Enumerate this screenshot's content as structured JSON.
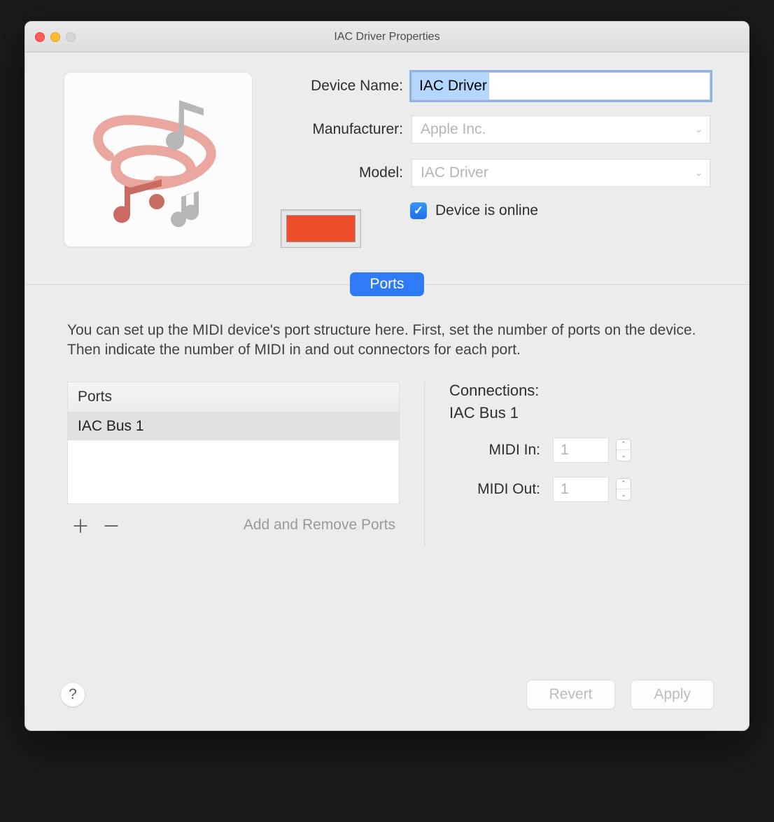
{
  "window": {
    "title": "IAC Driver Properties"
  },
  "form": {
    "device_name_label": "Device Name:",
    "device_name_value": "IAC Driver",
    "manufacturer_label": "Manufacturer:",
    "manufacturer_value": "Apple Inc.",
    "model_label": "Model:",
    "model_value": "IAC Driver",
    "online_label": "Device is online",
    "online_checked": true,
    "color": "#ed4d29"
  },
  "tabs": {
    "ports": "Ports"
  },
  "instructions": "You can set up the MIDI device's port structure here. First, set the number of ports on the device. Then indicate the number of MIDI in and out connectors for each port.",
  "ports": {
    "header": "Ports",
    "items": [
      "IAC Bus 1"
    ],
    "toolbar_caption": "Add and Remove Ports"
  },
  "connections": {
    "title": "Connections:",
    "bus": "IAC Bus 1",
    "midi_in_label": "MIDI In:",
    "midi_in_value": "1",
    "midi_out_label": "MIDI Out:",
    "midi_out_value": "1"
  },
  "footer": {
    "revert": "Revert",
    "apply": "Apply"
  }
}
